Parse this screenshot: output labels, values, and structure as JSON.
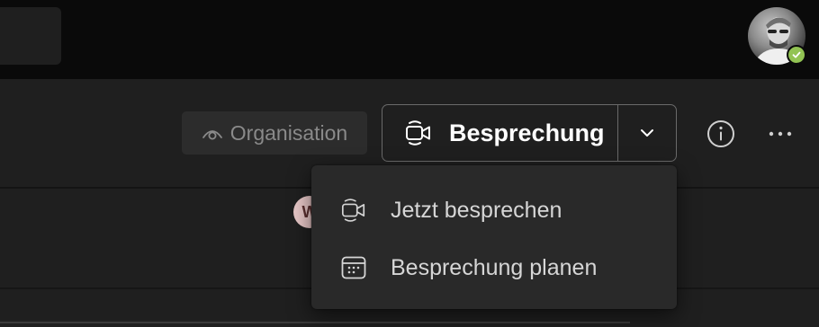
{
  "topbar": {
    "avatar_status": "available",
    "avatar_status_color": "#92c353"
  },
  "header": {
    "org_button_label": "Organisation",
    "meet_button_label": "Besprechung",
    "info_icon": "info-icon",
    "more_icon": "more-options-icon"
  },
  "chat": {
    "mini_avatar_initial": "W"
  },
  "dropdown": {
    "items": [
      {
        "label": "Jetzt besprechen",
        "icon": "video-camera-icon"
      },
      {
        "label": "Besprechung planen",
        "icon": "calendar-icon"
      }
    ]
  },
  "colors": {
    "topbar_bg": "#0a0a0a",
    "panel_bg": "#1f1f1f",
    "menu_bg": "#292929",
    "status_green": "#92c353"
  }
}
